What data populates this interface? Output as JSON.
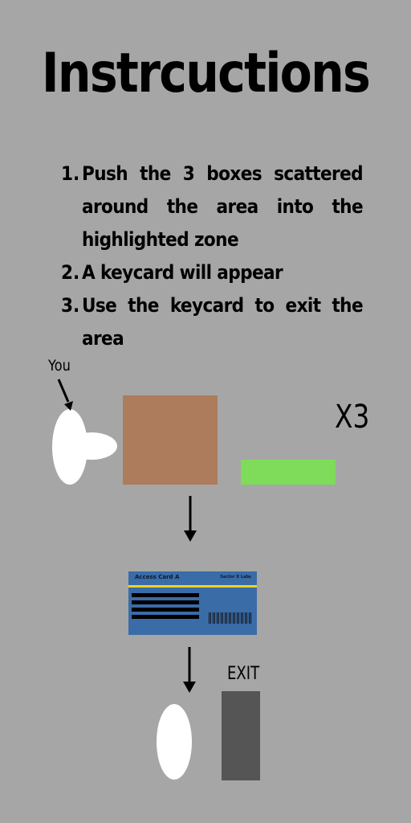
{
  "title": "Instrcuctions",
  "steps": [
    {
      "num": "1.",
      "text": "Push the 3 boxes scattered around the area into the highlighted zone"
    },
    {
      "num": "2.",
      "text": "A keycard will appear"
    },
    {
      "num": "3.",
      "text": "Use the keycard to exit the area"
    }
  ],
  "diagram": {
    "you_label": "You",
    "multiplier_label": "X3",
    "exit_label": "EXIT",
    "keycard": {
      "title": "Access Card A",
      "org": "Sector X Labs"
    }
  },
  "colors": {
    "background": "#a6a6a6",
    "box": "#ad7c5c",
    "zone": "#7fdb5a",
    "keycard": "#3a6ca8",
    "keycard_stripe": "#f2d21d",
    "exit_door": "#555555"
  }
}
